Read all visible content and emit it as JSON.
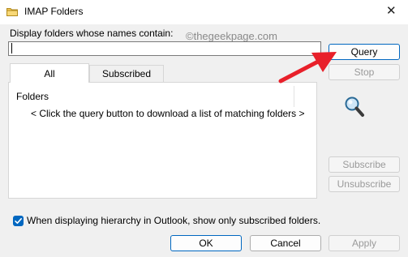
{
  "window": {
    "title": "IMAP Folders",
    "close_glyph": "✕"
  },
  "filter": {
    "label": "Display folders whose names contain:",
    "value": ""
  },
  "watermark": "©thegeekpage.com",
  "tabs": [
    {
      "label": "All",
      "active": true
    },
    {
      "label": "Subscribed",
      "active": false
    }
  ],
  "folder_list": {
    "column_header": "Folders",
    "empty_message": "< Click the query button to download a list of matching folders >"
  },
  "buttons": {
    "query": "Query",
    "stop": "Stop",
    "subscribe": "Subscribe",
    "unsubscribe": "Unsubscribe",
    "ok": "OK",
    "cancel": "Cancel",
    "apply": "Apply"
  },
  "options": {
    "subscribed_only_label": "When displaying hierarchy in Outlook, show only subscribed folders.",
    "subscribed_only_checked": true
  },
  "colors": {
    "accent": "#0067c0",
    "annotation_arrow": "#e8202a"
  },
  "icons": {
    "title": "folder-icon",
    "search": "magnifier-icon",
    "checkbox": "checkmark-icon"
  }
}
